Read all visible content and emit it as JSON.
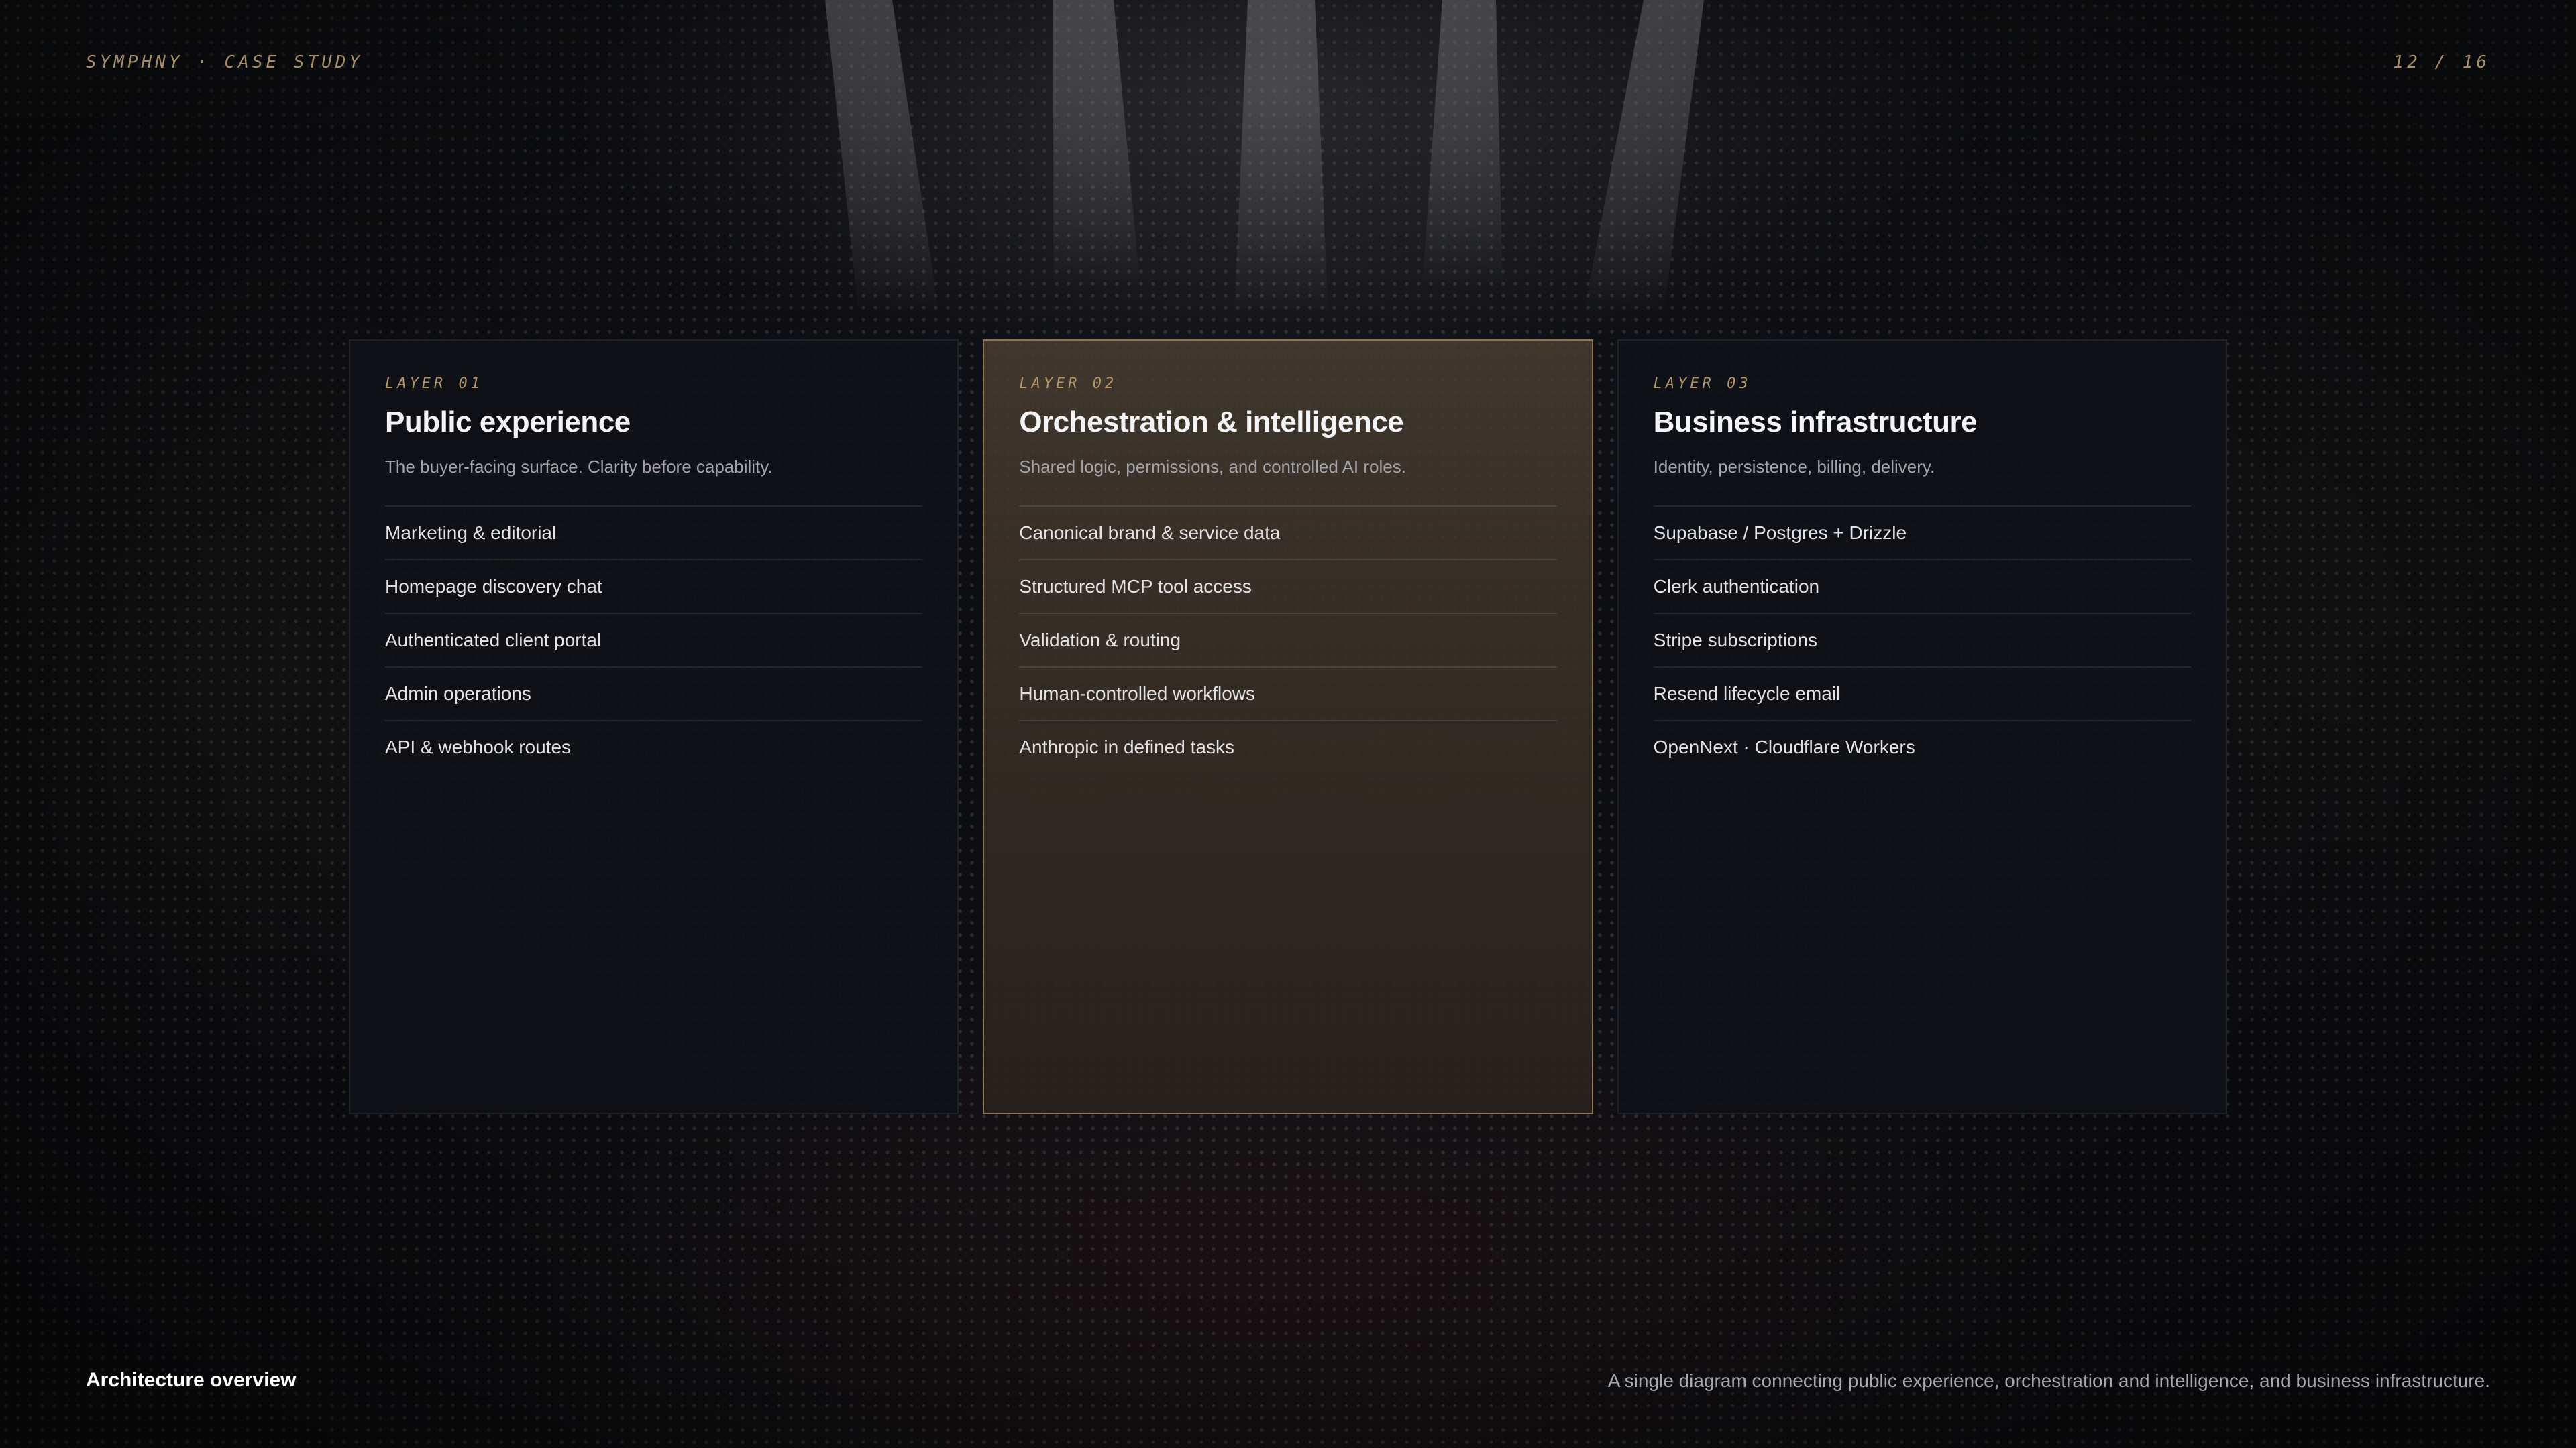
{
  "header": {
    "brand": "SYMPHNY · CASE STUDY",
    "page_indicator": "12 / 16"
  },
  "layers": [
    {
      "label": "LAYER 01",
      "title": "Public experience",
      "subtitle": "The buyer-facing surface. Clarity before capability.",
      "items": [
        "Marketing & editorial",
        "Homepage discovery chat",
        "Authenticated client portal",
        "Admin operations",
        "API & webhook routes"
      ],
      "highlighted": false
    },
    {
      "label": "LAYER 02",
      "title": "Orchestration & intelligence",
      "subtitle": "Shared logic, permissions, and controlled AI roles.",
      "items": [
        "Canonical brand & service data",
        "Structured MCP tool access",
        "Validation & routing",
        "Human-controlled workflows",
        "Anthropic in defined tasks"
      ],
      "highlighted": true
    },
    {
      "label": "LAYER 03",
      "title": "Business infrastructure",
      "subtitle": "Identity, persistence, billing, delivery.",
      "items": [
        "Supabase / Postgres + Drizzle",
        "Clerk authentication",
        "Stripe subscriptions",
        "Resend lifecycle email",
        "OpenNext · Cloudflare Workers"
      ],
      "highlighted": false
    }
  ],
  "footer": {
    "title": "Architecture overview",
    "caption": "A single diagram connecting public experience, orchestration and intelligence, and business infrastructure."
  },
  "colors": {
    "accent": "#a58d67",
    "highlight_border": "#8c7551",
    "background": "#0b0d12"
  }
}
